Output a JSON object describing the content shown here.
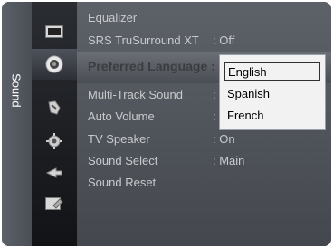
{
  "sidebar": {
    "label": "Sound"
  },
  "icons": [
    {
      "name": "picture-icon"
    },
    {
      "name": "speaker-icon"
    },
    {
      "name": "channel-icon"
    },
    {
      "name": "setup-icon"
    },
    {
      "name": "input-icon"
    },
    {
      "name": "application-icon"
    }
  ],
  "menu": {
    "items": [
      {
        "label": "Equalizer",
        "value": ""
      },
      {
        "label": "SRS TruSurround XT",
        "value": ": Off"
      },
      {
        "label": "Preferred Language :",
        "value": ""
      },
      {
        "label": "Multi-Track Sound",
        "value": ":"
      },
      {
        "label": "Auto Volume",
        "value": ":"
      },
      {
        "label": "TV Speaker",
        "value": ": On"
      },
      {
        "label": "Sound Select",
        "value": ": Main"
      },
      {
        "label": "Sound Reset",
        "value": ""
      }
    ],
    "selected_index": 2
  },
  "dropdown": {
    "options": [
      "English",
      "Spanish",
      "French"
    ],
    "selected": "English"
  },
  "colors": {
    "sidebar_bg": "#5c6068",
    "menu_bg": "#5d6168",
    "dropdown_bg": "#f2f2f2"
  }
}
